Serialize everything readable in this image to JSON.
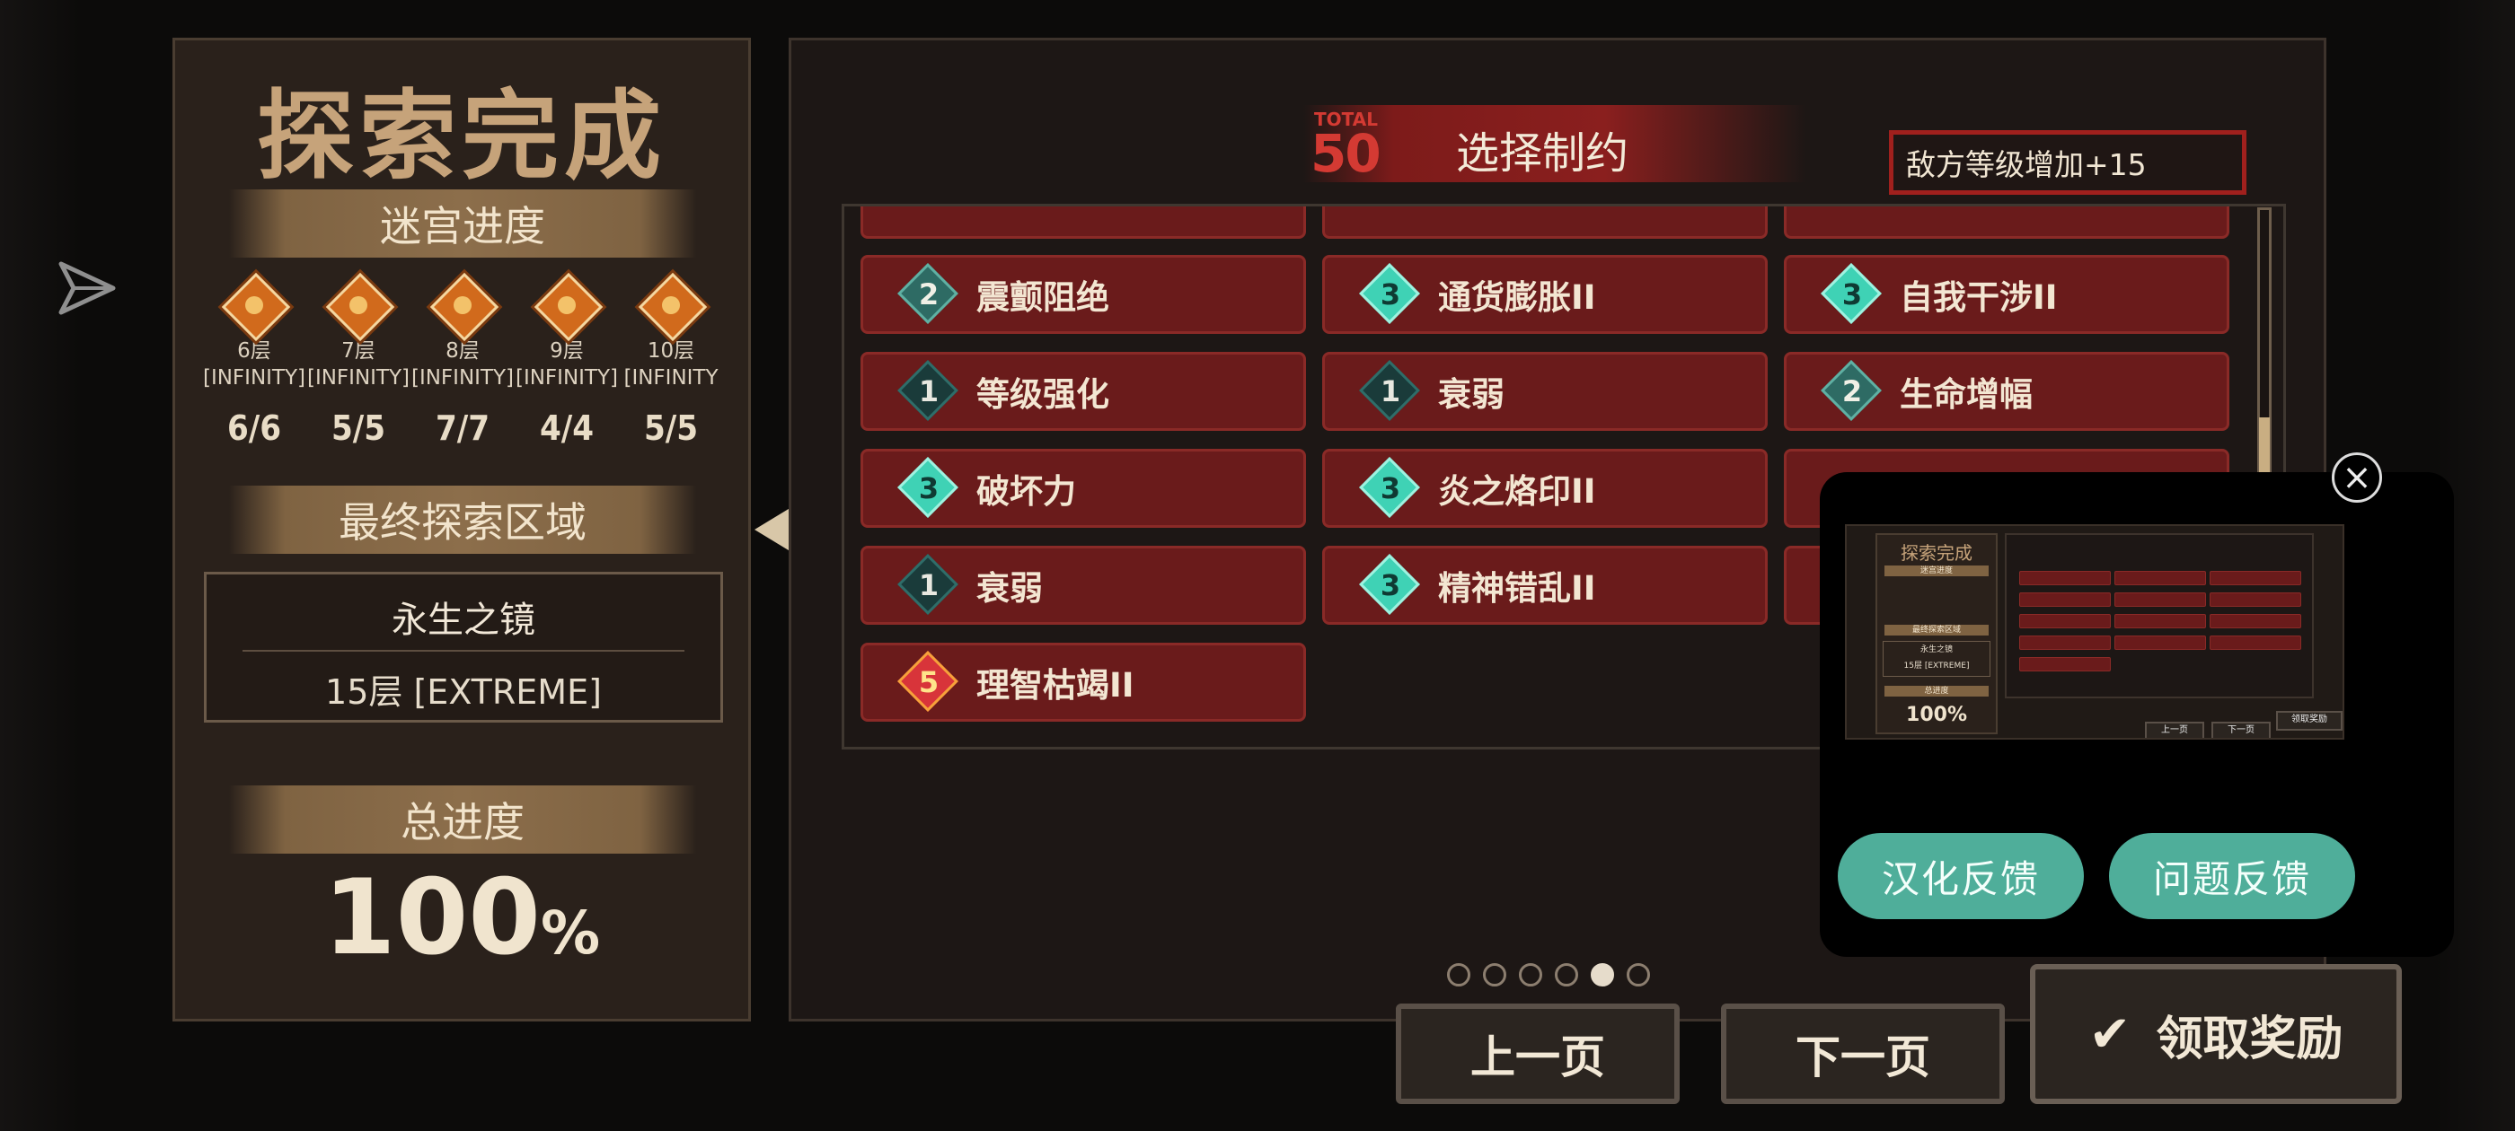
{
  "left_panel": {
    "title": "探索完成",
    "maze_progress_label": "迷宫进度",
    "floors": [
      {
        "floor": "6层",
        "mode": "[INFINITY]",
        "count": "6/6"
      },
      {
        "floor": "7层",
        "mode": "[INFINITY]",
        "count": "5/5"
      },
      {
        "floor": "8层",
        "mode": "[INFINITY]",
        "count": "7/7"
      },
      {
        "floor": "9层",
        "mode": "[INFINITY]",
        "count": "4/4"
      },
      {
        "floor": "10层",
        "mode": "[INFINITY",
        "count": "5/5"
      }
    ],
    "final_area_label": "最终探索区域",
    "final_area_name": "永生之镜",
    "final_area_floor": "15层 [EXTREME]",
    "total_progress_label": "总进度",
    "total_progress_value": "100",
    "total_progress_unit": "%"
  },
  "header": {
    "total_label": "TOTAL",
    "total_value": "50",
    "title": "选择制约",
    "enemy_level": "敌方等级增加+15"
  },
  "constraints": [
    {
      "level": "2",
      "name": "震颤阻绝"
    },
    {
      "level": "3",
      "name": "通货膨胀II"
    },
    {
      "level": "3",
      "name": "自我干涉II"
    },
    {
      "level": "1",
      "name": "等级强化"
    },
    {
      "level": "1",
      "name": "衰弱"
    },
    {
      "level": "2",
      "name": "生命增幅"
    },
    {
      "level": "3",
      "name": "破坏力"
    },
    {
      "level": "3",
      "name": "炎之烙印II"
    },
    {
      "level": "1",
      "name": "衰弱"
    },
    {
      "level": "3",
      "name": "精神错乱II"
    },
    {
      "level": "5",
      "name": "理智枯竭II"
    }
  ],
  "pagination": {
    "total": 6,
    "active_index": 4
  },
  "buttons": {
    "prev": "上一页",
    "next": "下一页",
    "claim": "领取奖励"
  },
  "overlay": {
    "feedback_localization": "汉化反馈",
    "feedback_issue": "问题反馈",
    "close_symbol": "×",
    "thumbnail": {
      "title": "探索完成",
      "maze": "迷宫进度",
      "area_label": "最终探索区域",
      "area_name": "永生之镜",
      "area_floor": "15层 [EXTREME]",
      "total_label": "总进度",
      "total": "100%",
      "prev": "上一页",
      "next": "下一页",
      "claim": "领取奖励"
    }
  },
  "colors": {
    "constraint_bg": "#6a1b1b",
    "accent_red": "#a0201d",
    "feedback_green": "#4fae9a",
    "banner_gold": "#8c6e4b"
  }
}
